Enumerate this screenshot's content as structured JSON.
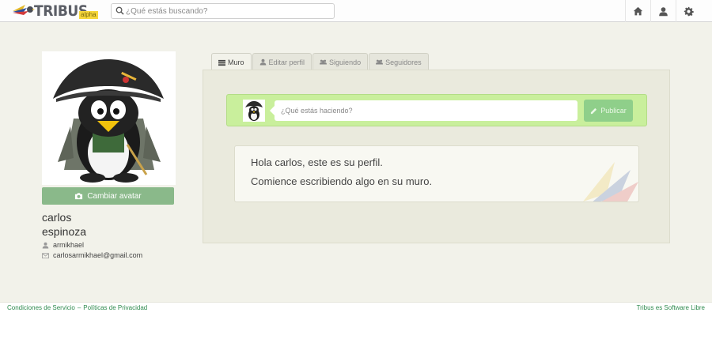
{
  "header": {
    "logo": {
      "name": "TRIBUS",
      "badge": "alpha"
    },
    "search": {
      "placeholder": "¿Qué estás buscando?",
      "value": ""
    },
    "nav_icons": [
      "home-icon",
      "user-icon",
      "gear-icon"
    ]
  },
  "profile": {
    "change_avatar_label": "Cambiar avatar",
    "first_name": "carlos",
    "last_name": "espinoza",
    "username": "armikhael",
    "email": "carlosarmikhael@gmail.com"
  },
  "tabs": [
    {
      "label": "Muro",
      "icon": "list-icon",
      "active": true
    },
    {
      "label": "Editar perfil",
      "icon": "user-icon",
      "active": false
    },
    {
      "label": "Siguiendo",
      "icon": "group-icon",
      "active": false
    },
    {
      "label": "Seguidores",
      "icon": "group-icon",
      "active": false
    }
  ],
  "composer": {
    "placeholder": "¿Qué estás haciendo?",
    "publish_label": "Publicar"
  },
  "welcome": {
    "line1": "Hola carlos, este es su perfil.",
    "line2": "Comience escribiendo algo en su muro."
  },
  "footer": {
    "terms": "Condiciones de Servicio",
    "separator": "–",
    "privacy": "Políticas de Privacidad",
    "right": "Tribus es Software Libre"
  },
  "colors": {
    "accent_green": "#8ab98a",
    "composer_bg": "#c9ef9c",
    "page_bg": "#f2f2ea",
    "link_green": "#2f8b4f"
  }
}
